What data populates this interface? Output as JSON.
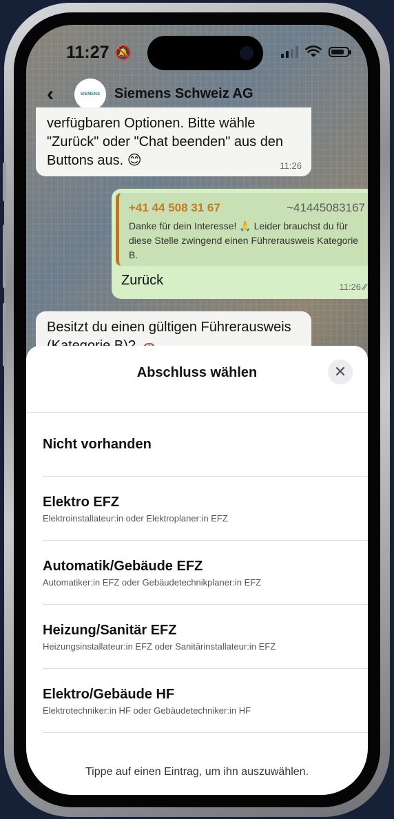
{
  "status_bar": {
    "time": "11:27"
  },
  "chat": {
    "name": "Siemens Schweiz AG",
    "avatar_text": "SIEMENS",
    "messages": [
      {
        "type": "incoming",
        "text": "verfügbaren Optionen. Bitte wähle \"Zurück\" oder \"Chat beenden\" aus den Buttons aus. 😊",
        "time": "11:26"
      },
      {
        "type": "outgoing",
        "quoted_phone": "+41 44 508 31 67",
        "quoted_alias": "~41445083167",
        "quoted_text": "Danke für dein Interesse! 🙏 Leider brauchst du für diese Stelle zwingend einen Führerausweis Kategorie B.",
        "text": "Zurück",
        "time": "11:26"
      },
      {
        "type": "incoming",
        "text": "Besitzt du einen gültigen Führerausweis (Kategorie B)? 🚗"
      }
    ]
  },
  "sheet": {
    "title": "Abschluss wählen",
    "close_icon": "close-icon",
    "options": [
      {
        "title": "Nicht vorhanden",
        "subtitle": ""
      },
      {
        "title": "Elektro EFZ",
        "subtitle": "Elektroinstallateur:in oder Elektroplaner:in EFZ"
      },
      {
        "title": "Automatik/Gebäude EFZ",
        "subtitle": "Automatiker:in EFZ oder Gebäudetechnikplaner:in EFZ"
      },
      {
        "title": "Heizung/Sanitär EFZ",
        "subtitle": "Heizungsinstallateur:in EFZ oder Sanitärinstallateur:in EFZ"
      },
      {
        "title": "Elektro/Gebäude HF",
        "subtitle": "Elektrotechniker:in HF oder Gebäudetechniker:in HF"
      }
    ],
    "hint": "Tippe auf einen Eintrag, um ihn auszuwählen."
  }
}
